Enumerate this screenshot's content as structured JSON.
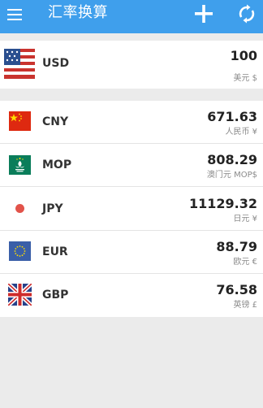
{
  "app_bar": {
    "title": "汇率换算",
    "color": "#3f9fec",
    "icons": [
      "menu-icon",
      "add-icon",
      "refresh-icon"
    ]
  },
  "base": {
    "code": "USD",
    "amount": "100",
    "unit": "美元 $",
    "flag": "us-flag-icon"
  },
  "currencies": [
    {
      "code": "CNY",
      "amount": "671.63",
      "unit": "人民币 ¥",
      "flag": "china-flag-icon"
    },
    {
      "code": "MOP",
      "amount": "808.29",
      "unit": "澳门元 MOP$",
      "flag": "macau-flag-icon"
    },
    {
      "code": "JPY",
      "amount": "11129.32",
      "unit": "日元 ¥",
      "flag": "japan-flag-icon"
    },
    {
      "code": "EUR",
      "amount": "88.79",
      "unit": "欧元 €",
      "flag": "eu-flag-icon"
    },
    {
      "code": "GBP",
      "amount": "76.58",
      "unit": "英镑 £",
      "flag": "uk-flag-icon"
    }
  ]
}
